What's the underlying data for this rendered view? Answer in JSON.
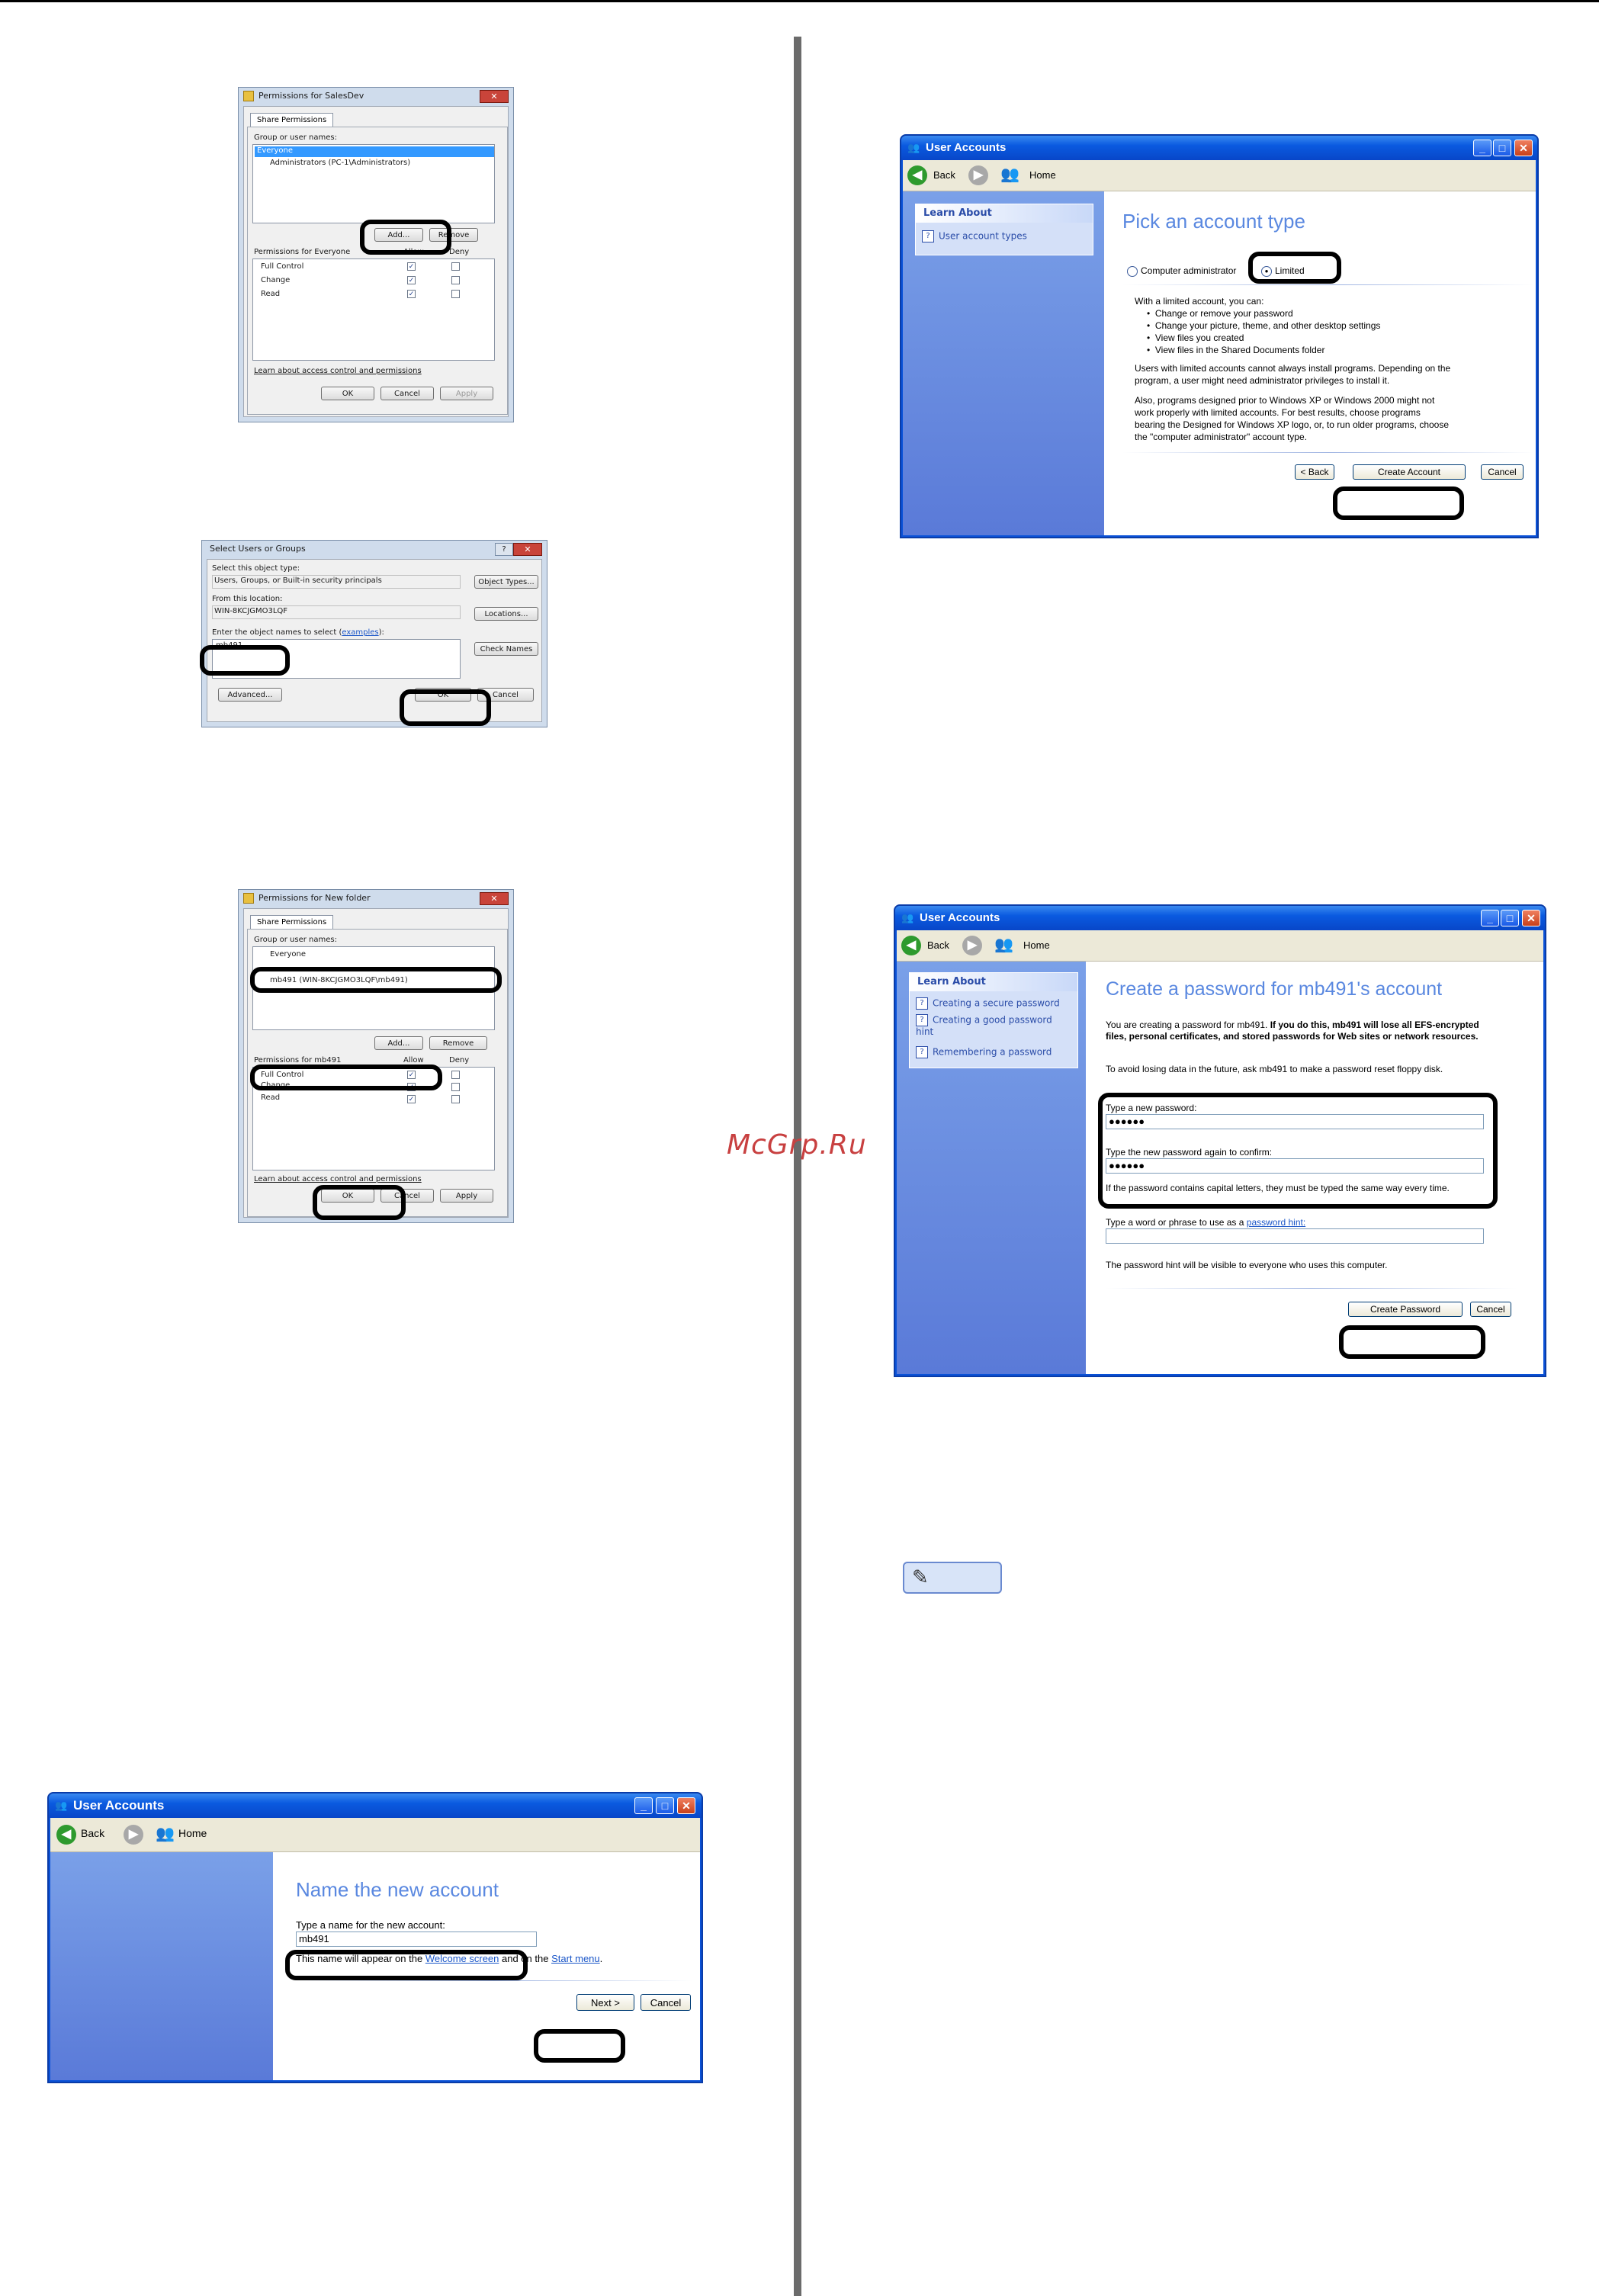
{
  "watermark": "McGrp.Ru",
  "dlg_salesdev": {
    "title": "Permissions for SalesDev",
    "tab": "Share Permissions",
    "group_label": "Group or user names:",
    "users": [
      "Everyone",
      "Administrators (PC-1\\Administrators)"
    ],
    "add": "Add...",
    "remove": "Remove",
    "perm_label": "Permissions for Everyone",
    "allow": "Allow",
    "deny": "Deny",
    "perms": [
      "Full Control",
      "Change",
      "Read"
    ],
    "link": "Learn about access control and permissions",
    "ok": "OK",
    "cancel": "Cancel",
    "apply": "Apply"
  },
  "dlg_select": {
    "title": "Select Users or Groups",
    "type_label": "Select this object type:",
    "type_value": "Users, Groups, or Built-in security principals",
    "object_types": "Object Types...",
    "loc_label": "From this location:",
    "loc_value": "WIN-8KCJGMO3LQF",
    "locations": "Locations...",
    "names_label": "Enter the object names to select",
    "names_link": "examples",
    "names_value": "mb491",
    "check_names": "Check Names",
    "advanced": "Advanced...",
    "ok": "OK",
    "cancel": "Cancel"
  },
  "dlg_newfolder": {
    "title": "Permissions for New folder",
    "tab": "Share Permissions",
    "group_label": "Group or user names:",
    "users": [
      "Everyone",
      "mb491 (WIN-8KCJGMO3LQF\\mb491)"
    ],
    "add": "Add...",
    "remove": "Remove",
    "perm_label": "Permissions for mb491",
    "allow": "Allow",
    "deny": "Deny",
    "perms": [
      "Full Control",
      "Change",
      "Read"
    ],
    "link": "Learn about access control and permissions",
    "ok": "OK",
    "cancel": "Cancel",
    "apply": "Apply"
  },
  "win_name": {
    "title": "User Accounts",
    "back": "Back",
    "home": "Home",
    "heading": "Name the new account",
    "prompt": "Type a name for the new account:",
    "value": "mb491",
    "note_pre": "This name will appear on the ",
    "note_link1": "Welcome screen",
    "note_mid": " and on the ",
    "note_link2": "Start menu",
    "note_end": ".",
    "next": "Next >",
    "cancel": "Cancel"
  },
  "win_type": {
    "title": "User Accounts",
    "back": "Back",
    "home": "Home",
    "learn_about": "Learn About",
    "learn_item": "User account types",
    "heading": "Pick an account type",
    "opt_admin": "Computer administrator",
    "opt_limited": "Limited",
    "intro": "With a limited account, you can:",
    "bullets": [
      "Change or remove your password",
      "Change your picture, theme, and other desktop settings",
      "View files you created",
      "View files in the Shared Documents folder"
    ],
    "para1_l1": "Users with limited accounts cannot always install programs. Depending on the",
    "para1_l2": "program, a user might need administrator privileges to install it.",
    "para2_l1": "Also, programs designed prior to Windows XP or Windows 2000 might not",
    "para2_l2": "work properly with limited accounts. For best results, choose programs",
    "para2_l3": "bearing the Designed for Windows XP logo, or, to run older programs, choose",
    "para2_l4": "the \"computer administrator\" account type.",
    "back_btn": "< Back",
    "create": "Create Account",
    "cancel": "Cancel"
  },
  "win_pw": {
    "title": "User Accounts",
    "back": "Back",
    "home": "Home",
    "learn_about": "Learn About",
    "learn_items": [
      "Creating a secure password",
      "Creating a good password hint",
      "Remembering a password"
    ],
    "heading": "Create a password for mb491's account",
    "intro_a": "You are creating a password for mb491. ",
    "intro_b": "If you do this, mb491 will lose all EFS-encrypted files, personal certificates, and stored passwords for Web sites or network resources.",
    "avoid": "To avoid losing data in the future, ask mb491 to make a password reset floppy disk.",
    "new_label": "Type a new password:",
    "new_value": "●●●●●●",
    "confirm_label": "Type the new password again to confirm:",
    "confirm_value": "●●●●●●",
    "caps_note": "If the password contains capital letters, they must be typed the same way every time.",
    "hint_label": "Type a word or phrase to use as a ",
    "hint_link": "password hint:",
    "hint_note": "The password hint will be visible to everyone who uses this computer.",
    "create": "Create Password",
    "cancel": "Cancel"
  },
  "memo_icon": "memo-pencil-icon"
}
